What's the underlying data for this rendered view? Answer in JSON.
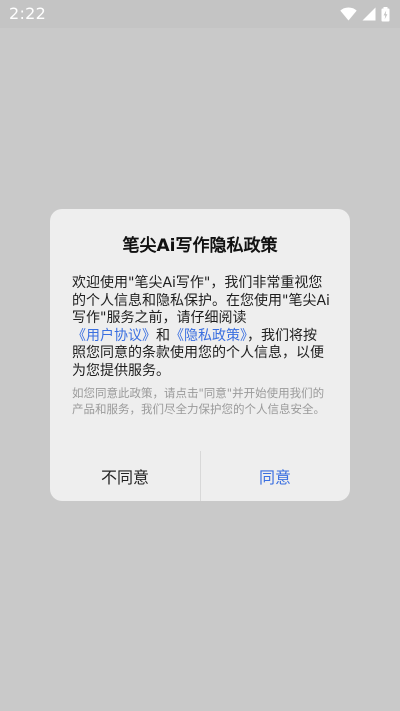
{
  "status_bar": {
    "time": "2:22",
    "icons": [
      "wifi-icon",
      "signal-icon",
      "battery-icon"
    ]
  },
  "dialog": {
    "title": "笔尖Ai写作隐私政策",
    "body_part1": "欢迎使用\"笔尖Ai写作\"，我们非常重视您的个人信息和隐私保护。在您使用\"笔尖Ai写作\"服务之前，请仔细阅读",
    "user_agreement_link": "《用户协议》",
    "body_and": "和",
    "privacy_policy_link": "《隐私政策》",
    "body_part2": "，我们将按照您同意的条款使用您的个人信息，以便为您提供服务。",
    "note": "如您同意此政策，请点击\"同意\"并开始使用我们的产品和服务，我们尽全力保护您的个人信息安全。",
    "disagree_label": "不同意",
    "agree_label": "同意"
  },
  "colors": {
    "link": "#3a6fe0",
    "overlay": "#c9c9c9",
    "dialog_bg": "#eeeeee"
  }
}
